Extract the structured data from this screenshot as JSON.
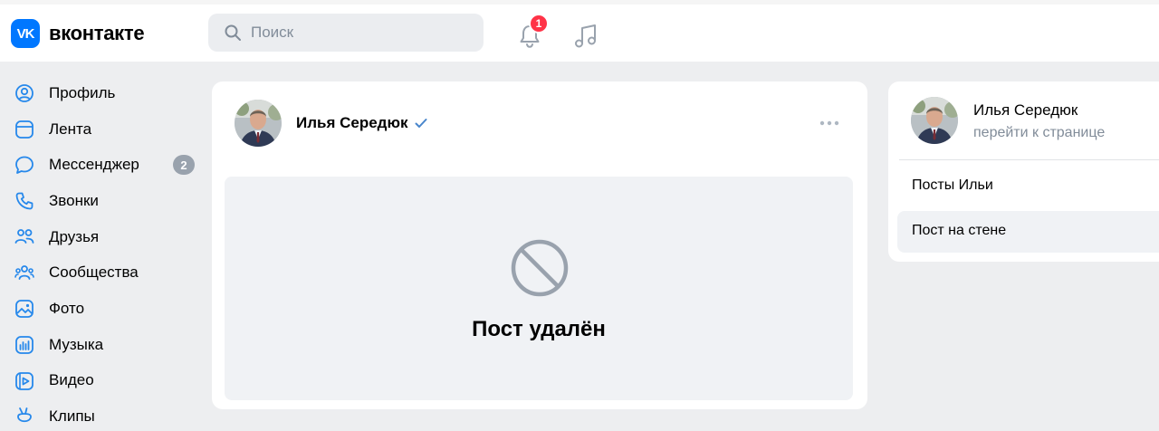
{
  "header": {
    "logo_icon": "VK",
    "logo_text": "вконтакте",
    "search": {
      "placeholder": "Поиск",
      "value": ""
    },
    "notifications": {
      "count": "1",
      "icon": "bell-icon"
    },
    "music_icon": "music-icon"
  },
  "sidebar": {
    "items": [
      {
        "label": "Профиль",
        "icon": "profile-icon"
      },
      {
        "label": "Лента",
        "icon": "feed-icon"
      },
      {
        "label": "Мессенджер",
        "icon": "messenger-icon",
        "count": "2"
      },
      {
        "label": "Звонки",
        "icon": "phone-icon"
      },
      {
        "label": "Друзья",
        "icon": "friends-icon"
      },
      {
        "label": "Сообщества",
        "icon": "communities-icon"
      },
      {
        "label": "Фото",
        "icon": "photo-icon"
      },
      {
        "label": "Музыка",
        "icon": "music-icon"
      },
      {
        "label": "Видео",
        "icon": "video-icon"
      },
      {
        "label": "Клипы",
        "icon": "clips-icon"
      }
    ]
  },
  "post": {
    "author": "Илья Середюк",
    "verified": true,
    "deleted_text": "Пост удалён"
  },
  "right_panel": {
    "name": "Илья Середюк",
    "link": "перейти к странице",
    "menu": [
      {
        "label": "Посты Ильи",
        "active": false
      },
      {
        "label": "Пост на стене",
        "active": true
      }
    ]
  },
  "colors": {
    "accent": "#0077ff",
    "badge_red": "#ff3347",
    "background": "#edeef0",
    "muted_text": "#818c99",
    "verified": "#4986cc"
  }
}
